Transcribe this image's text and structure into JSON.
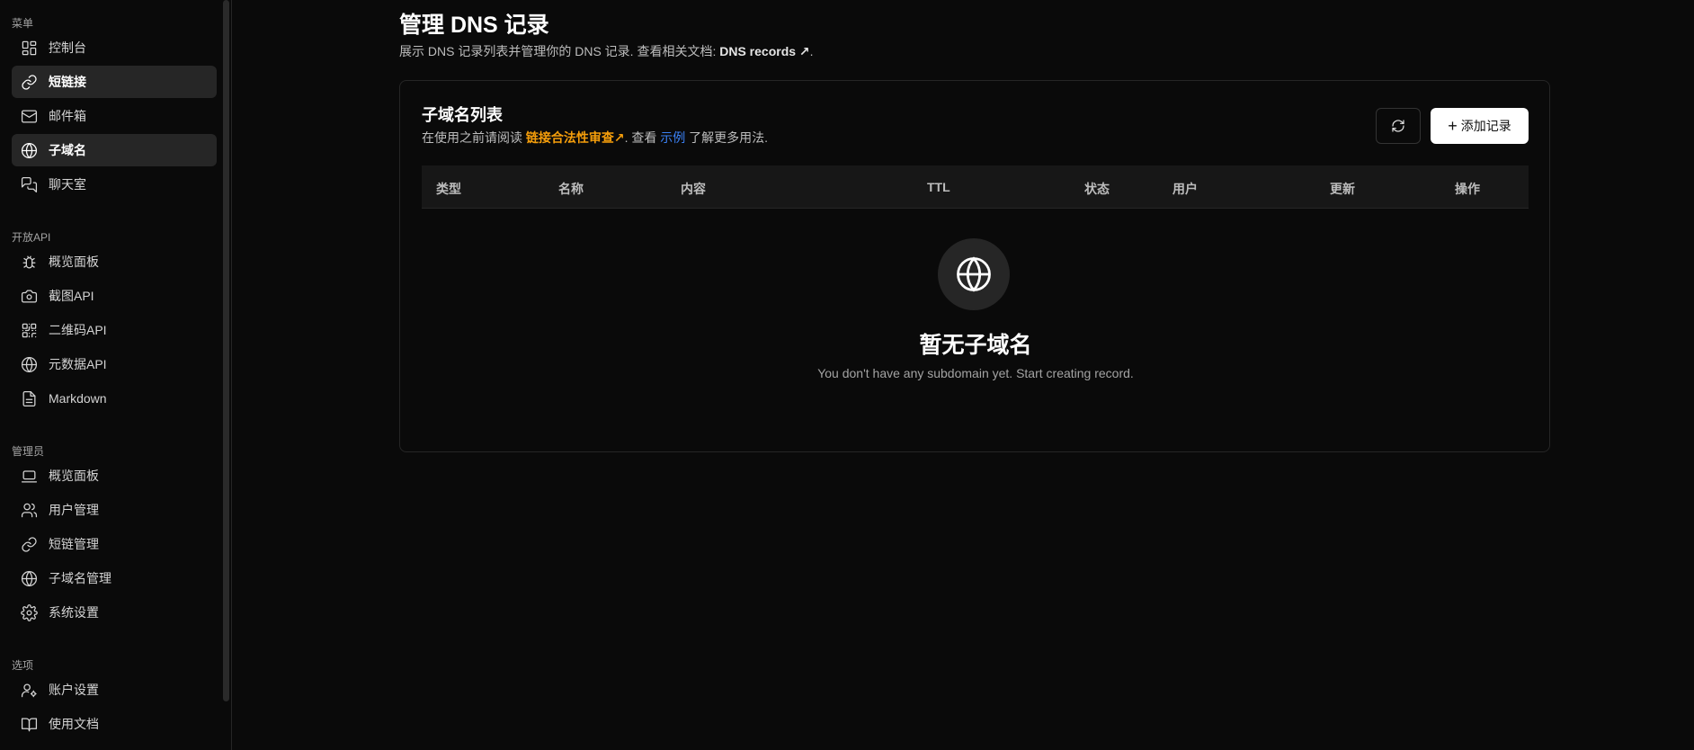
{
  "sidebar": {
    "sections": [
      {
        "title": "菜单",
        "items": [
          {
            "label": "控制台",
            "icon": "dashboard-icon"
          },
          {
            "label": "短链接",
            "icon": "link-icon",
            "active": true
          },
          {
            "label": "邮件箱",
            "icon": "mail-icon"
          },
          {
            "label": "子域名",
            "icon": "globe-icon",
            "active": true
          },
          {
            "label": "聊天室",
            "icon": "chat-icon"
          }
        ]
      },
      {
        "title": "开放API",
        "items": [
          {
            "label": "概览面板",
            "icon": "bug-icon"
          },
          {
            "label": "截图API",
            "icon": "camera-icon"
          },
          {
            "label": "二维码API",
            "icon": "qrcode-icon"
          },
          {
            "label": "元数据API",
            "icon": "globe-icon"
          },
          {
            "label": "Markdown",
            "icon": "file-icon"
          }
        ]
      },
      {
        "title": "管理员",
        "items": [
          {
            "label": "概览面板",
            "icon": "laptop-icon"
          },
          {
            "label": "用户管理",
            "icon": "users-icon"
          },
          {
            "label": "短链管理",
            "icon": "link-icon"
          },
          {
            "label": "子域名管理",
            "icon": "globe-icon"
          },
          {
            "label": "系统设置",
            "icon": "gear-icon"
          }
        ]
      },
      {
        "title": "选项",
        "items": [
          {
            "label": "账户设置",
            "icon": "user-gear-icon"
          },
          {
            "label": "使用文档",
            "icon": "book-icon"
          }
        ]
      }
    ]
  },
  "header": {
    "title": "管理 DNS 记录",
    "desc_prefix": "展示 DNS 记录列表并管理你的 DNS 记录. 查看相关文档: ",
    "doc_link": "DNS records ↗",
    "desc_suffix": "."
  },
  "card": {
    "title": "子域名列表",
    "sub_prefix": "在使用之前请阅读 ",
    "sub_warn_link": "链接合法性审查↗",
    "sub_mid": ". 查看 ",
    "sub_example_link": "示例",
    "sub_suffix": " 了解更多用法.",
    "add_label": "添加记录",
    "columns": [
      "类型",
      "名称",
      "内容",
      "TTL",
      "状态",
      "用户",
      "更新",
      "操作"
    ],
    "empty_title": "暂无子域名",
    "empty_desc": "You don't have any subdomain yet. Start creating record."
  },
  "colors": {
    "accent_warn": "#f59e0b",
    "accent_link": "#3b82f6",
    "background": "#0a0a0a"
  }
}
